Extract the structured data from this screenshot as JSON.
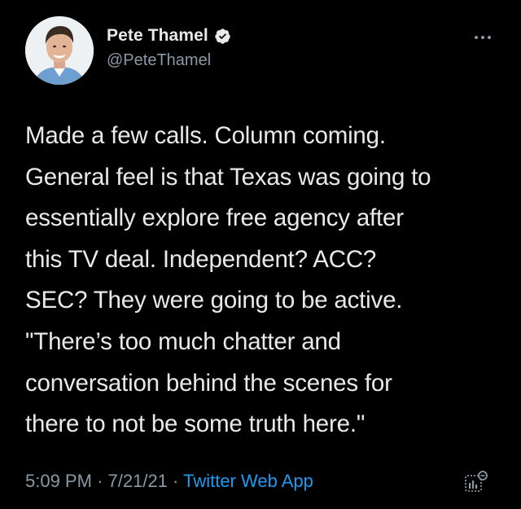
{
  "author": {
    "display_name": "Pete Thamel",
    "handle": "@PeteThamel",
    "verified": true
  },
  "tweet": {
    "text": "Made a few calls. Column coming.\nGeneral feel is that Texas was going to\nessentially explore free agency after\nthis TV deal. Independent? ACC?\nSEC? They were going to be active.\n\"There’s too much chatter and\nconversation behind the scenes for\nthere to not be some truth here.\"",
    "time": "5:09 PM",
    "date": "7/21/21",
    "separator": "·",
    "source": "Twitter Web App"
  },
  "icons": {
    "verified": "verified-badge-icon",
    "more": "more-options-icon",
    "analytics": "tweet-analytics-icon"
  },
  "colors": {
    "background": "#000000",
    "text": "#e7e9ea",
    "secondary": "#8b98a5",
    "accent": "#1d9bf0"
  }
}
